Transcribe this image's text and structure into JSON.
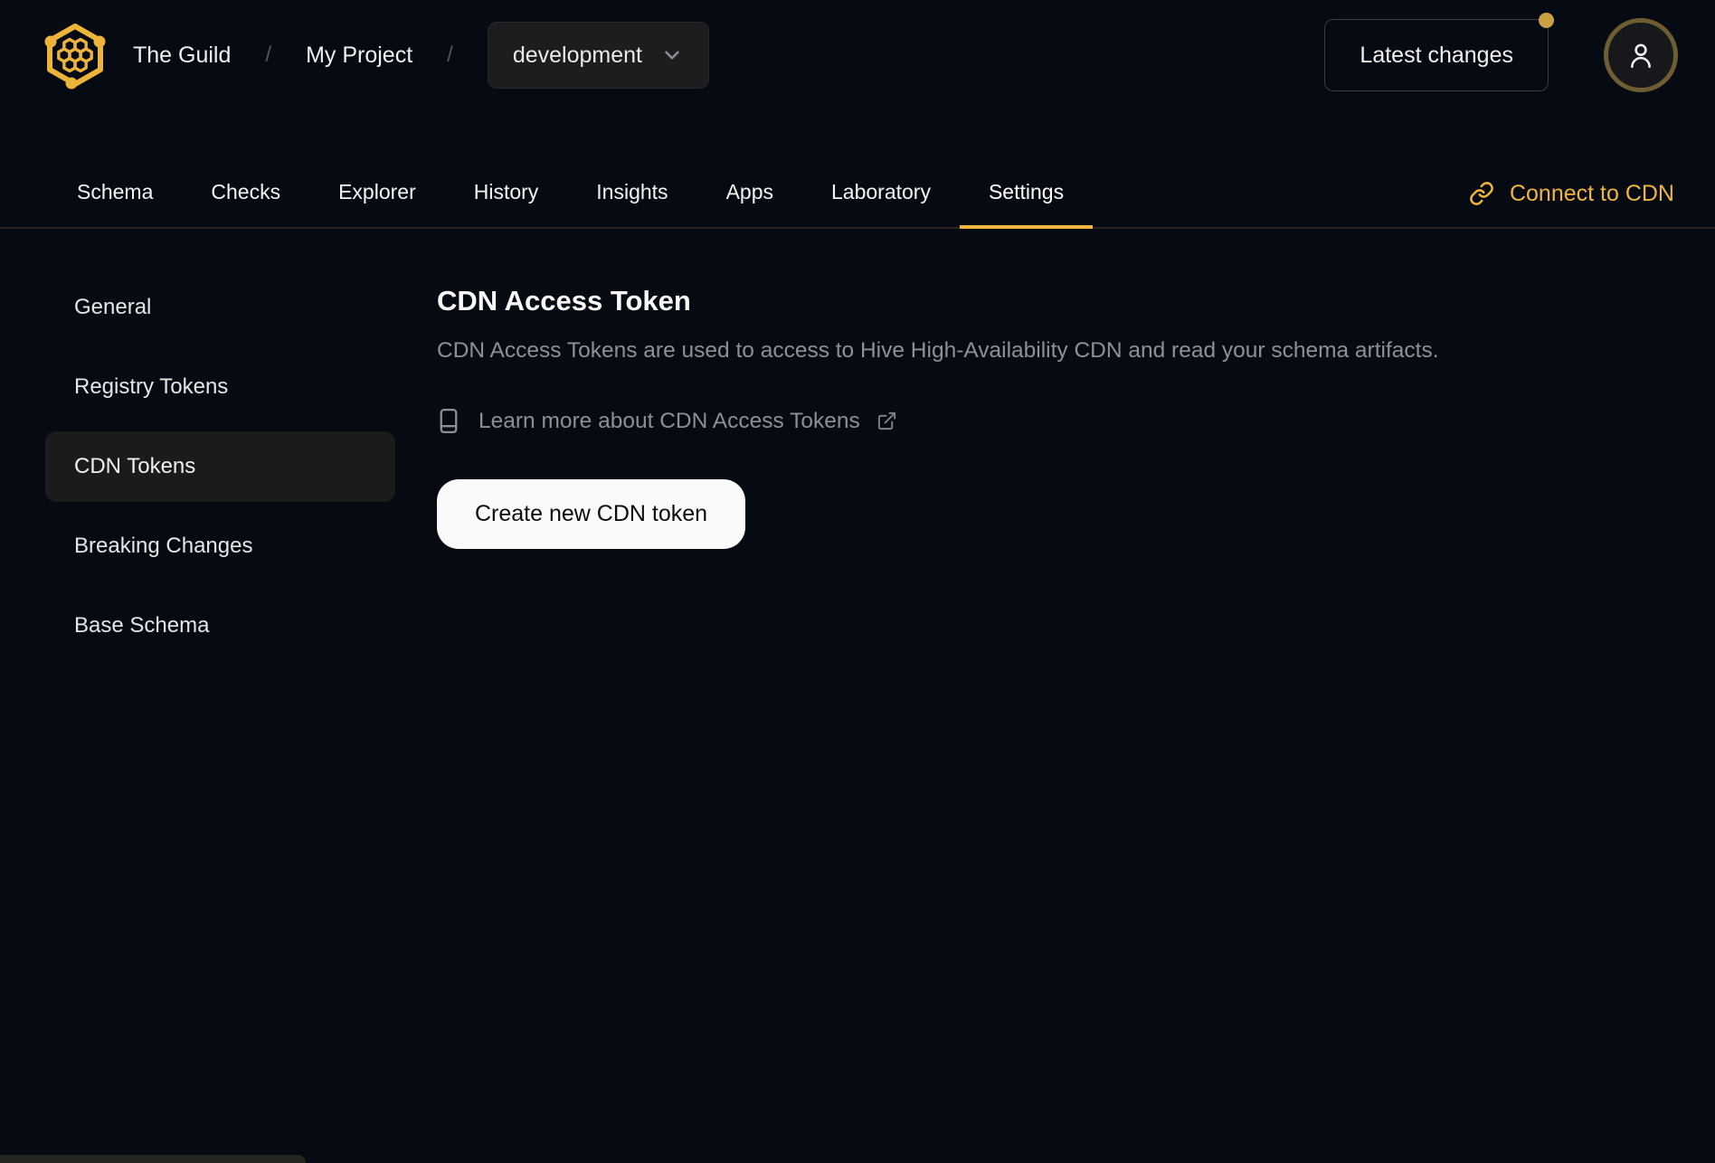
{
  "header": {
    "org": "The Guild",
    "project": "My Project",
    "separator": "/",
    "target": "development",
    "latest_changes_label": "Latest changes"
  },
  "tabbar": {
    "connect_label": "Connect to CDN",
    "items": [
      {
        "label": "Schema",
        "active": false
      },
      {
        "label": "Checks",
        "active": false
      },
      {
        "label": "Explorer",
        "active": false
      },
      {
        "label": "History",
        "active": false
      },
      {
        "label": "Insights",
        "active": false
      },
      {
        "label": "Apps",
        "active": false
      },
      {
        "label": "Laboratory",
        "active": false
      },
      {
        "label": "Settings",
        "active": true
      }
    ]
  },
  "sidebar": {
    "items": [
      {
        "label": "General",
        "active": false
      },
      {
        "label": "Registry Tokens",
        "active": false
      },
      {
        "label": "CDN Tokens",
        "active": true
      },
      {
        "label": "Breaking Changes",
        "active": false
      },
      {
        "label": "Base Schema",
        "active": false
      }
    ]
  },
  "main": {
    "title": "CDN Access Token",
    "description": "CDN Access Tokens are used to access to Hive High-Availability CDN and read your schema artifacts.",
    "learn_more_label": "Learn more about CDN Access Tokens",
    "create_button_label": "Create new CDN token"
  },
  "icons": {
    "logo": "hive-hexagon-logo-icon",
    "dropdown": "chevron-down-icon",
    "user": "user-icon",
    "connect": "link-icon",
    "learn_more_left": "book-icon",
    "learn_more_right": "external-link-icon"
  },
  "colors": {
    "background": "#060a12",
    "accent": "#f1b440",
    "muted_text": "#8f9094",
    "active_item_bg": "#1b1b1b",
    "button_bg": "#fafafa",
    "avatar_ring": "#6e5c33",
    "notification_dot": "#c9a144"
  }
}
